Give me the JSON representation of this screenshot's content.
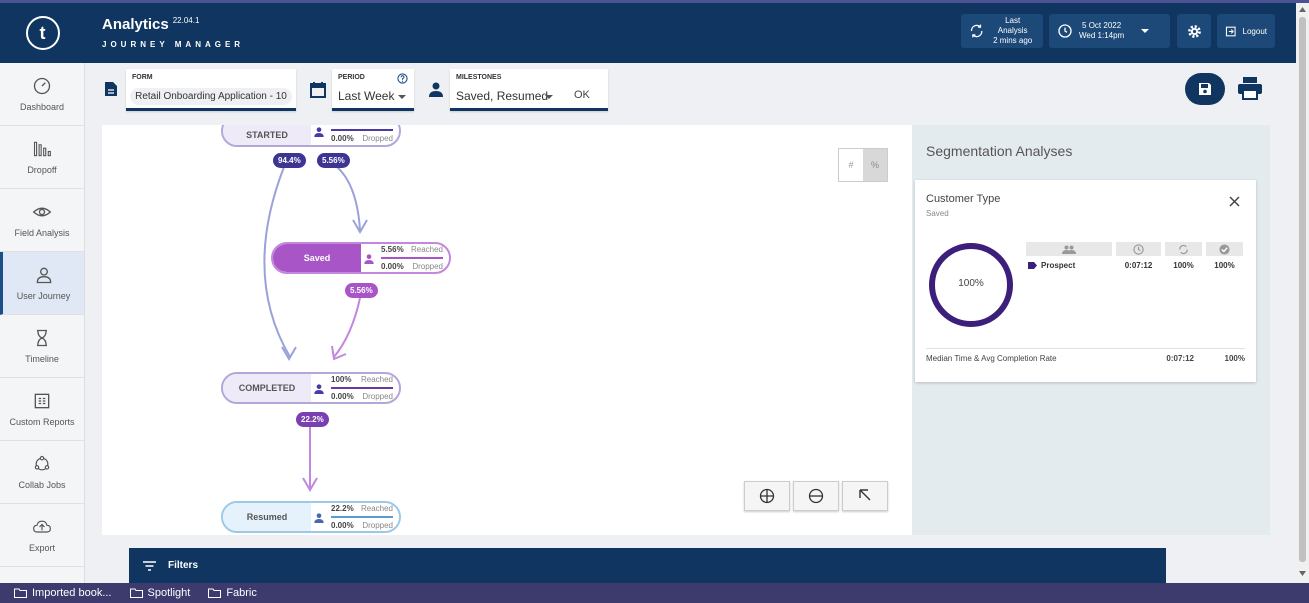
{
  "app": {
    "logo_letter": "t",
    "title": "Analytics",
    "version": "22.04.1",
    "subtitle": "JOURNEY MANAGER"
  },
  "header": {
    "last_analysis_line1": "Last Analysis",
    "last_analysis_line2": "2 mins ago",
    "date_line1": "5 Oct 2022",
    "date_line2": "Wed 1:14pm",
    "logout_label": "Logout"
  },
  "sidebar": {
    "items": [
      {
        "label": "Dashboard",
        "icon": "gauge-icon"
      },
      {
        "label": "Dropoff",
        "icon": "dropoff-bars-icon"
      },
      {
        "label": "Field Analysis",
        "icon": "eye-icon"
      },
      {
        "label": "User Journey",
        "icon": "user-icon",
        "active": true
      },
      {
        "label": "Timeline",
        "icon": "hourglass-icon"
      },
      {
        "label": "Custom Reports",
        "icon": "report-icon"
      },
      {
        "label": "Collab Jobs",
        "icon": "collab-icon"
      },
      {
        "label": "Export",
        "icon": "cloud-upload-icon"
      }
    ]
  },
  "toolbar": {
    "form_label": "FORM",
    "form_value": "Retail Onboarding Application - 10",
    "period_label": "PERIOD",
    "period_value": "Last Week",
    "milestones_label": "MILESTONES",
    "milestones_value": "Saved, Resumed",
    "ok_label": "OK"
  },
  "journey": {
    "nodes": [
      {
        "name": "STARTED",
        "reached": "",
        "dropped": "0.00%",
        "dropped_label": "Dropped"
      },
      {
        "name": "Saved",
        "reached": "5.56%",
        "reached_label": "Reached",
        "dropped": "0.00%",
        "dropped_label": "Dropped"
      },
      {
        "name": "COMPLETED",
        "reached": "100%",
        "reached_label": "Reached",
        "dropped": "0.00%",
        "dropped_label": "Dropped"
      },
      {
        "name": "Resumed",
        "reached": "22.2%",
        "reached_label": "Reached",
        "dropped": "0.00%",
        "dropped_label": "Dropped"
      }
    ],
    "edges": [
      {
        "from": "STARTED",
        "to": "COMPLETED",
        "label": "94.4%"
      },
      {
        "from": "STARTED",
        "to": "Saved",
        "label": "5.56%"
      },
      {
        "from": "Saved",
        "to": "COMPLETED",
        "label": "5.56%"
      },
      {
        "from": "COMPLETED",
        "to": "Resumed",
        "label": "22.2%"
      }
    ],
    "toggle_count": "#",
    "toggle_percent": "%"
  },
  "segmentation": {
    "title": "Segmentation Analyses",
    "card_title": "Customer Type",
    "card_sub": "Saved",
    "donut_label": "100%",
    "donut_value": 1.0,
    "row": {
      "name": "Prospect",
      "time": "0:07:12",
      "rate1": "100%",
      "rate2": "100%"
    },
    "footer_label": "Median Time & Avg Completion Rate",
    "footer_time": "0:07:12",
    "footer_rate": "100%"
  },
  "filters": {
    "label": "Filters"
  },
  "bookmarks": [
    {
      "label": "Imported book..."
    },
    {
      "label": "Spotlight"
    },
    {
      "label": "Fabric"
    }
  ],
  "colors": {
    "navy": "#0f3560",
    "purple_dark": "#4a3aa8",
    "purple": "#a855c8",
    "donut": "#3b1f7a"
  }
}
